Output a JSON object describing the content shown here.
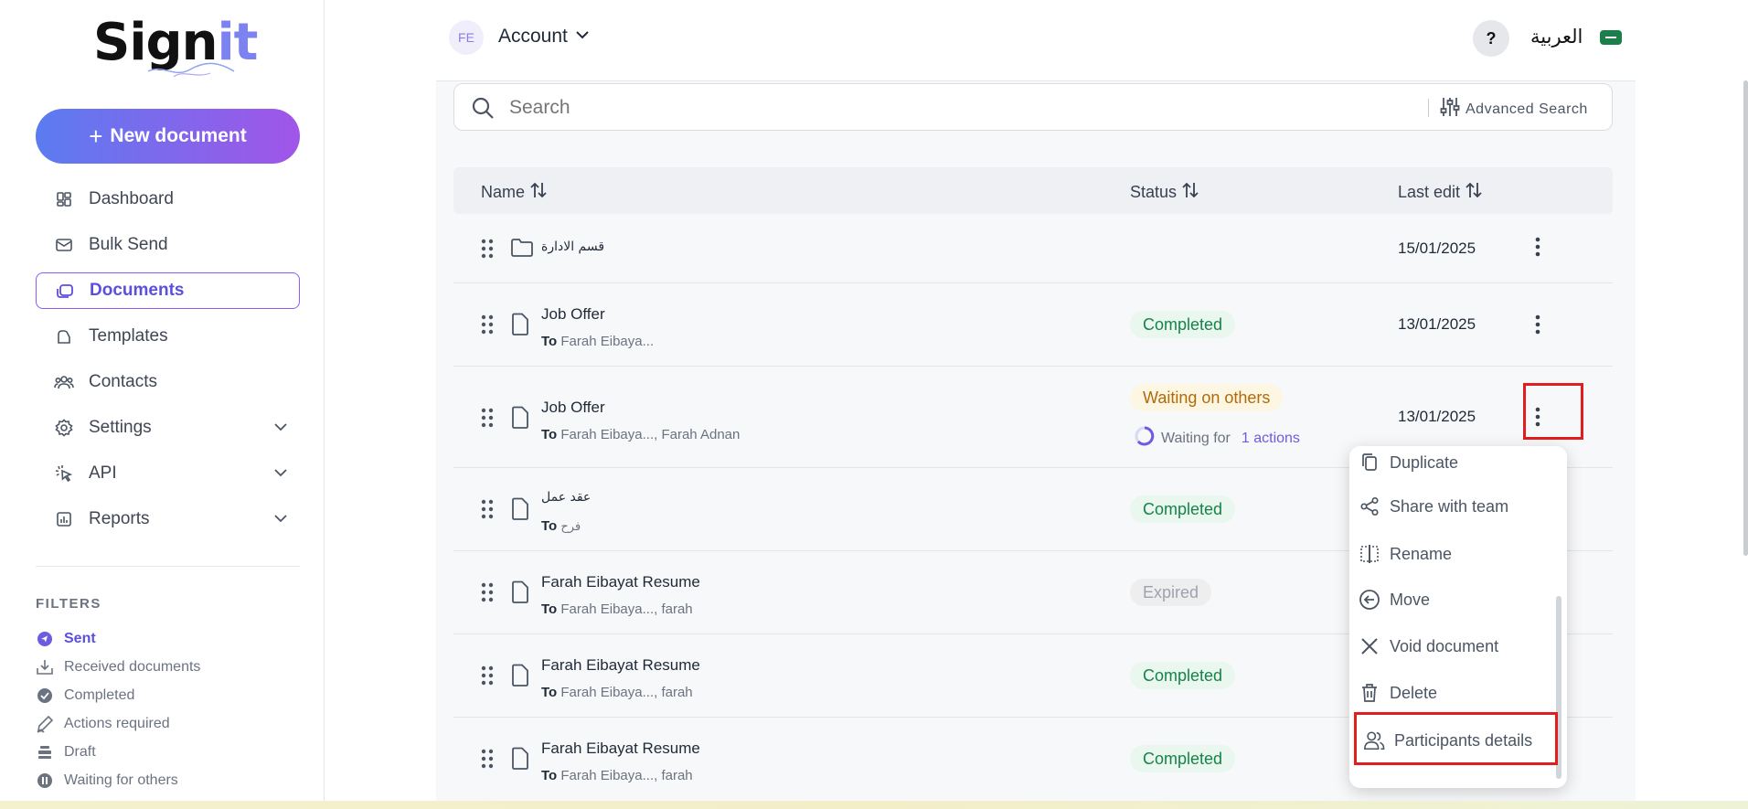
{
  "app": {
    "logo_main": "Sign",
    "logo_accent": "it",
    "brand_gradient": [
      "#5b7cf0",
      "#a155e8"
    ],
    "accent": "#5b4fe0"
  },
  "sidebar": {
    "new_document": "New document",
    "nav": [
      {
        "label": "Dashboard",
        "icon": "dashboard-icon"
      },
      {
        "label": "Bulk Send",
        "icon": "mail-icon"
      },
      {
        "label": "Documents",
        "icon": "documents-icon",
        "active": true
      },
      {
        "label": "Templates",
        "icon": "template-icon"
      },
      {
        "label": "Contacts",
        "icon": "contacts-icon"
      },
      {
        "label": "Settings",
        "icon": "gear-icon",
        "expandable": true
      },
      {
        "label": "API",
        "icon": "api-icon",
        "expandable": true
      },
      {
        "label": "Reports",
        "icon": "reports-icon",
        "expandable": true
      }
    ],
    "filters_title": "FILTERS",
    "filters": [
      {
        "label": "Sent",
        "active": true
      },
      {
        "label": "Received documents"
      },
      {
        "label": "Completed"
      },
      {
        "label": "Actions required"
      },
      {
        "label": "Draft"
      },
      {
        "label": "Waiting for others"
      }
    ]
  },
  "topbar": {
    "avatar_initials": "FE",
    "account_label": "Account",
    "help": "?",
    "language": "العربية"
  },
  "search": {
    "placeholder": "Search",
    "advanced": "Advanced Search"
  },
  "table": {
    "columns": {
      "name": "Name",
      "status": "Status",
      "last_edit": "Last edit"
    },
    "rows": [
      {
        "type": "folder",
        "name": "قسم الادارة",
        "to_label": "",
        "to": "",
        "status": "",
        "date": "15/01/2025"
      },
      {
        "type": "file",
        "name": "Job Offer",
        "to_label": "To",
        "to": "Farah Eibaya...",
        "status": "Completed",
        "date": "13/01/2025"
      },
      {
        "type": "file",
        "name": "Job Offer",
        "to_label": "To",
        "to": "Farah Eibaya..., Farah Adnan",
        "status": "Waiting on others",
        "waiting_text": "Waiting for",
        "waiting_actions": "1 actions",
        "date": "13/01/2025"
      },
      {
        "type": "file",
        "name": "عقد عمل",
        "to_label": "To",
        "to": "فرح",
        "status": "Completed",
        "date": ""
      },
      {
        "type": "file",
        "name": "Farah Eibayat Resume",
        "to_label": "To",
        "to": "Farah Eibaya..., farah",
        "status": "Expired",
        "date": ""
      },
      {
        "type": "file",
        "name": "Farah Eibayat Resume",
        "to_label": "To",
        "to": "Farah Eibaya..., farah",
        "status": "Completed",
        "date": ""
      },
      {
        "type": "file",
        "name": "Farah Eibayat Resume",
        "to_label": "To",
        "to": "Farah Eibaya..., farah",
        "status": "Completed",
        "date": ""
      }
    ]
  },
  "context_menu": {
    "items": [
      {
        "label": "Duplicate",
        "icon": "copy-icon"
      },
      {
        "label": "Share with team",
        "icon": "share-icon"
      },
      {
        "label": "Rename",
        "icon": "rename-icon"
      },
      {
        "label": "Move",
        "icon": "move-icon"
      },
      {
        "label": "Void document",
        "icon": "close-icon"
      },
      {
        "label": "Delete",
        "icon": "trash-icon"
      },
      {
        "label": "Participants details",
        "icon": "participants-icon"
      }
    ]
  },
  "status_colors": {
    "completed": "#16834a",
    "waiting": "#b26a06",
    "expired": "#9ca3af",
    "highlight": "#e11d1d"
  }
}
